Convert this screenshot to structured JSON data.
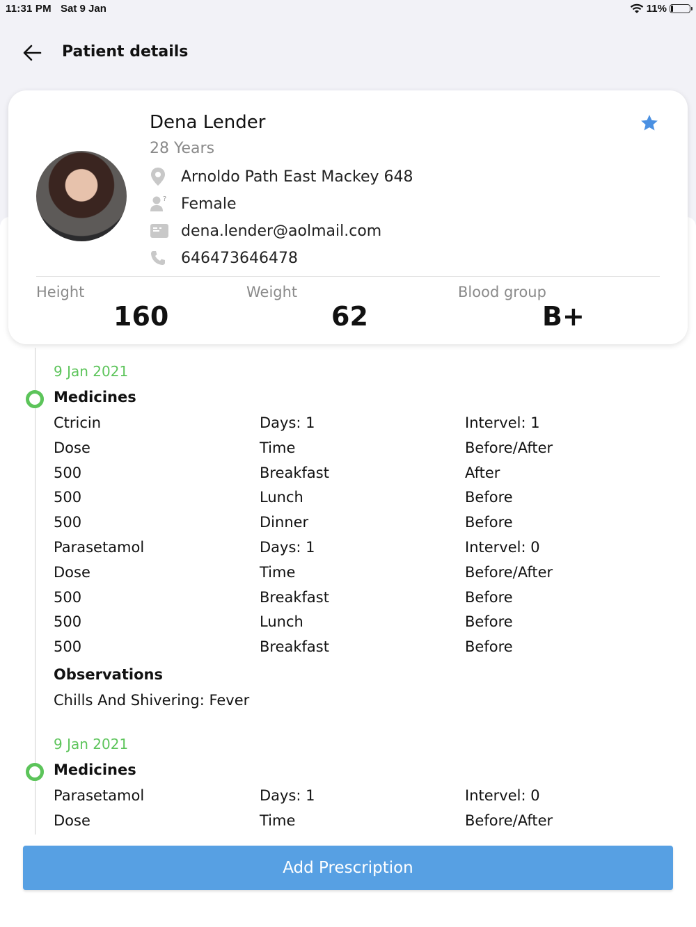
{
  "status_bar": {
    "time": "11:31 PM",
    "date": "Sat 9 Jan",
    "battery": "11%",
    "battery_level": 0.11
  },
  "header": {
    "title": "Patient details",
    "back_icon": "arrow-left-icon"
  },
  "patient": {
    "name": "Dena Lender",
    "age": "28 Years",
    "address": "Arnoldo Path East Mackey 648",
    "gender": "Female",
    "email": "dena.lender@aolmail.com",
    "phone": "646473646478",
    "favorite_icon": "star-icon",
    "accent_color": "#4a90e2"
  },
  "stats": [
    {
      "label": "Height",
      "value": "160"
    },
    {
      "label": "Weight",
      "value": "62"
    },
    {
      "label": "Blood group",
      "value": "B+"
    }
  ],
  "timeline": [
    {
      "date": "9 Jan 2021",
      "medicines_heading": "Medicines",
      "rows": [
        [
          "Ctricin",
          "Days:  1",
          "Intervel: 1"
        ],
        [
          "Dose",
          "Time",
          "Before/After"
        ],
        [
          "500",
          "Breakfast",
          "After"
        ],
        [
          "500",
          "Lunch",
          "Before"
        ],
        [
          "500",
          "Dinner",
          "Before"
        ],
        [
          "Parasetamol",
          "Days:  1",
          "Intervel: 0"
        ],
        [
          "Dose",
          "Time",
          "Before/After"
        ],
        [
          "500",
          "Breakfast",
          "Before"
        ],
        [
          "500",
          "Lunch",
          "Before"
        ],
        [
          "500",
          "Breakfast",
          "Before"
        ]
      ],
      "observations_heading": "Observations",
      "observations": "Chills And Shivering: Fever"
    },
    {
      "date": "9 Jan 2021",
      "medicines_heading": "Medicines",
      "rows": [
        [
          "Parasetamol",
          "Days:  1",
          "Intervel: 0"
        ],
        [
          "Dose",
          "Time",
          "Before/After"
        ]
      ]
    }
  ],
  "actions": {
    "add_prescription": "Add Prescription",
    "button_color": "#57a0e3"
  },
  "colors": {
    "timeline_green": "#5cc45a",
    "background": "#f2f2f7"
  }
}
